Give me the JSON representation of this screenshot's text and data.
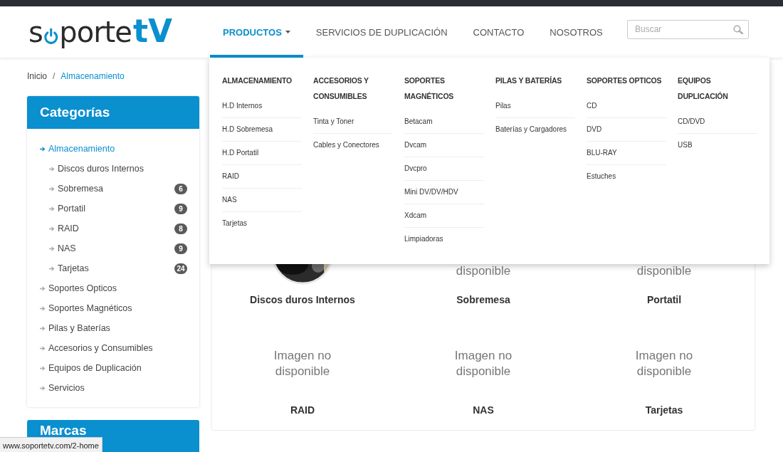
{
  "logo": {
    "before_icon": "s",
    "after_icon": "porte",
    "accent": "tV"
  },
  "nav": [
    {
      "label": "PRODUCTOS",
      "selected": true,
      "has_caret": true
    },
    {
      "label": "SERVICIOS DE DUPLICACIÓN",
      "selected": false,
      "has_caret": false
    },
    {
      "label": "CONTACTO",
      "selected": false,
      "has_caret": false
    },
    {
      "label": "NOSOTROS",
      "selected": false,
      "has_caret": false
    }
  ],
  "search": {
    "placeholder": "Buscar"
  },
  "dropdown": {
    "columns": [
      {
        "heading": "ALMACENAMIENTO",
        "items": [
          "H.D Internos",
          "H.D Sobremesa",
          "H.D Portatil",
          "RAID",
          "NAS",
          "Tarjetas"
        ]
      },
      {
        "heading": "ACCESORIOS Y CONSUMIBLES",
        "items": [
          "Tinta y Toner",
          "Cables y Conectores"
        ]
      },
      {
        "heading": "SOPORTES MAGNÉTICOS",
        "items": [
          "Betacam",
          "Dvcam",
          "Dvcpro",
          "Mini DV/DV/HDV",
          "Xdcam",
          "Limpiadoras"
        ]
      },
      {
        "heading": "PILAS Y BATERÍAS",
        "items": [
          "Pilas",
          "Baterías y Cargadores"
        ]
      },
      {
        "heading": "SOPORTES OPTICOS",
        "items": [
          "CD",
          "DVD",
          "BLU-RAY",
          "Estuches"
        ]
      },
      {
        "heading": "EQUIPOS DUPLICACIÓN",
        "items": [
          "CD/DVD",
          "USB"
        ]
      }
    ]
  },
  "breadcrumb": [
    {
      "label": "Inicio",
      "current": false
    },
    {
      "label": "Almacenamiento",
      "current": true
    }
  ],
  "breadcrumb_separator": "/",
  "categories": {
    "title": "Categorías",
    "items": [
      {
        "label": "Almacenamiento",
        "selected": true,
        "children": [
          {
            "label": "Discos duros Internos",
            "selected": false
          },
          {
            "label": "Sobremesa",
            "selected": false,
            "count": "6"
          },
          {
            "label": "Portatil",
            "selected": false,
            "count": "9"
          },
          {
            "label": "RAID",
            "selected": false,
            "count": "8"
          },
          {
            "label": "NAS",
            "selected": false,
            "count": "9"
          },
          {
            "label": "Tarjetas",
            "selected": false,
            "count": "24"
          }
        ]
      },
      {
        "label": "Soportes Opticos",
        "selected": false
      },
      {
        "label": "Soportes Magnéticos",
        "selected": false
      },
      {
        "label": "Pilas y Baterías",
        "selected": false
      },
      {
        "label": "Accesorios y Consumibles",
        "selected": false
      },
      {
        "label": "Equipos de Duplicación",
        "selected": false
      },
      {
        "label": "Servicios",
        "selected": false
      }
    ]
  },
  "brands": {
    "title": "Marcas"
  },
  "subcategories": [
    {
      "label": "Discos duros Internos",
      "kind": "picture"
    },
    {
      "label": "Sobremesa",
      "kind": "placeholder",
      "image_text": "disponible"
    },
    {
      "label": "Portatil",
      "kind": "placeholder",
      "image_text": "disponible"
    },
    {
      "label": "RAID",
      "kind": "placeholder",
      "image_text": "Imagen no disponible"
    },
    {
      "label": "NAS",
      "kind": "placeholder",
      "image_text": "Imagen no disponible"
    },
    {
      "label": "Tarjetas",
      "kind": "placeholder",
      "image_text": "Imagen no disponible"
    }
  ],
  "status_bar": {
    "url": "www.soportetv.com/2-home"
  }
}
